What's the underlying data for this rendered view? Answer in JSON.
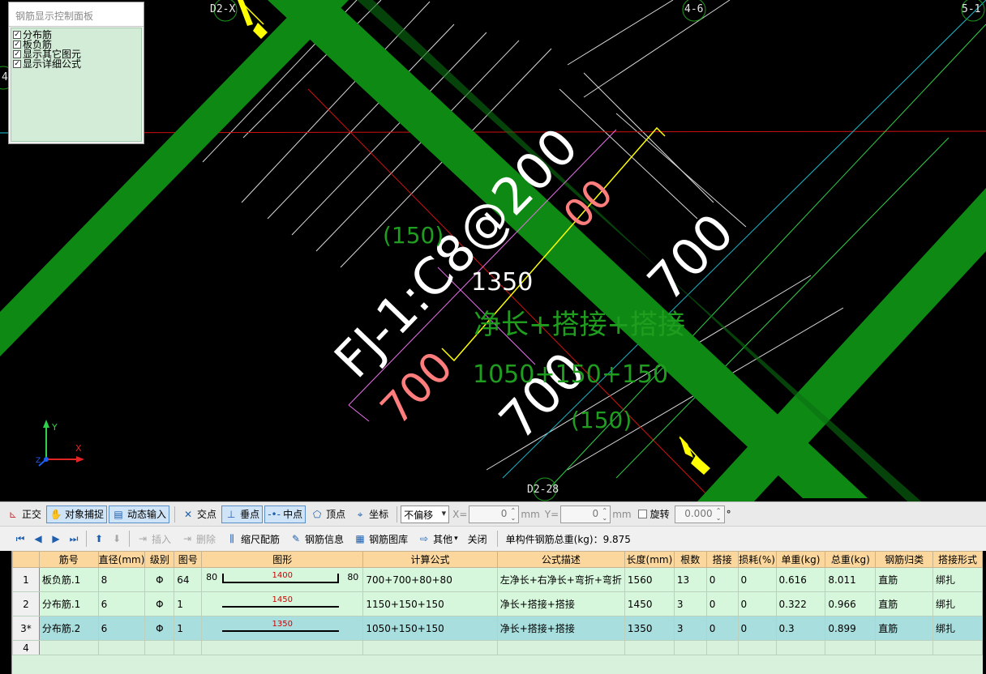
{
  "canvas": {
    "axis_labels": [
      "D2-X",
      "4-6",
      "5-1",
      "D2-28",
      "4"
    ],
    "texts": {
      "rebar_label": "FJ-1:C8@200",
      "dim_1350": "1350",
      "dim_150_a": "(150)",
      "dim_150_b": "(150)",
      "formula_desc": "净长+搭接+搭接",
      "formula": "1050+150+150",
      "dim_700_a": "700",
      "dim_700_b": "700",
      "dim_700_c": "700",
      "dim_00": "00"
    },
    "ucs": {
      "y": "Y",
      "x": "X",
      "z": "Z"
    },
    "colors": {
      "beam": "#0e8a14",
      "background": "#000000",
      "magenta": "#e76fe7",
      "dim_red": "#ff8a8a",
      "yellow": "#ffff00",
      "green_text": "#1f9d1f"
    }
  },
  "control_panel": {
    "title": "钢筋显示控制面板",
    "items": [
      {
        "label": "分布筋",
        "checked": true
      },
      {
        "label": "板负筋",
        "checked": true
      },
      {
        "label": "显示其它图元",
        "checked": true
      },
      {
        "label": "显示详细公式",
        "checked": true
      }
    ]
  },
  "toolbar1": {
    "ortho": "正交",
    "snap": "对象捕捉",
    "dynamic_input": "动态输入",
    "intersection": "交点",
    "perpendicular": "垂点",
    "midpoint": "中点",
    "vertex": "顶点",
    "coordinate": "坐标",
    "offset_mode": "不偏移",
    "x_label": "X=",
    "x_value": "0",
    "x_unit": "mm",
    "y_label": "Y=",
    "y_value": "0",
    "y_unit": "mm",
    "rotate_label": "旋转",
    "rotate_value": "0.000",
    "degree": "°"
  },
  "toolbar2": {
    "insert": "插入",
    "delete": "删除",
    "scale_rebar": "缩尺配筋",
    "rebar_info": "钢筋信息",
    "rebar_library": "钢筋图库",
    "other": "其他",
    "close": "关闭",
    "total_weight": "单构件钢筋总重(kg)：9.875"
  },
  "table": {
    "headers": [
      "筋号",
      "直径(mm)",
      "级别",
      "图号",
      "图形",
      "计算公式",
      "公式描述",
      "长度(mm)",
      "根数",
      "搭接",
      "损耗(%)",
      "单重(kg)",
      "总重(kg)",
      "钢筋归类",
      "搭接形式"
    ],
    "rows": [
      {
        "row_no": "1",
        "name": "板负筋.1",
        "diameter": "8",
        "grade": "Φ",
        "fig": "64",
        "shape_left": "80",
        "shape_len": "1400",
        "shape_right": "80",
        "formula": "700+700+80+80",
        "desc": "左净长+右净长+弯折+弯折",
        "length": "1560",
        "count": "13",
        "lap": "0",
        "loss": "0",
        "unit_weight": "0.616",
        "total_weight": "8.011",
        "category": "直筋",
        "lap_type": "绑扎"
      },
      {
        "row_no": "2",
        "name": "分布筋.1",
        "diameter": "6",
        "grade": "Φ",
        "fig": "1",
        "shape_len": "1450",
        "formula": "1150+150+150",
        "desc": "净长+搭接+搭接",
        "length": "1450",
        "count": "3",
        "lap": "0",
        "loss": "0",
        "unit_weight": "0.322",
        "total_weight": "0.966",
        "category": "直筋",
        "lap_type": "绑扎"
      },
      {
        "row_no": "3*",
        "name": "分布筋.2",
        "diameter": "6",
        "grade": "Φ",
        "fig": "1",
        "shape_len": "1350",
        "formula": "1050+150+150",
        "desc": "净长+搭接+搭接",
        "length": "1350",
        "count": "3",
        "lap": "0",
        "loss": "0",
        "unit_weight": "0.3",
        "total_weight": "0.899",
        "category": "直筋",
        "lap_type": "绑扎"
      },
      {
        "row_no": "4"
      }
    ]
  }
}
